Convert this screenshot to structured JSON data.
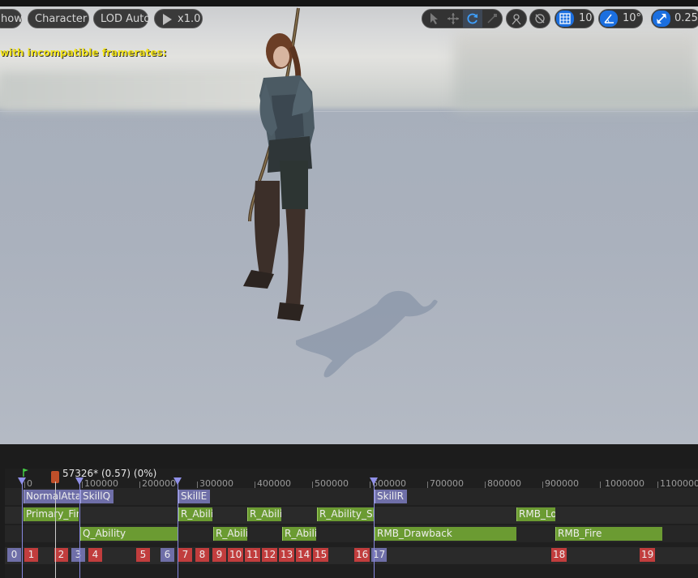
{
  "toolbar": {
    "show_label": "how",
    "character_label": "Character",
    "lod_label": "LOD Auto",
    "speed_label": "x1.0",
    "grid_value": "10",
    "angle_value": "10°",
    "scale_value": "0.25"
  },
  "viewport": {
    "warning": "with incompatible framerates:"
  },
  "timeline": {
    "scrub_label": "57326* (0.57) (0%)",
    "ruler": [
      "0",
      "100000",
      "200000",
      "300000",
      "400000",
      "500000",
      "600000",
      "700000",
      "800000",
      "900000",
      "1000000",
      "1100000"
    ],
    "row1": [
      "NormalAttack",
      "SkillQ",
      "SkillE",
      "SkillR"
    ],
    "row2": [
      "Primary_Fire",
      "R_Ability",
      "R_Ability",
      "R_Ability_Slot",
      "RMB_Loop"
    ],
    "row3": [
      "Q_Ability",
      "R_Ability",
      "R_Ability",
      "RMB_Drawback",
      "RMB_Fire"
    ],
    "markers": [
      "0",
      "1",
      "2",
      "3",
      "4",
      "5",
      "6",
      "7",
      "8",
      "9",
      "10",
      "11",
      "12",
      "13",
      "14",
      "15",
      "16",
      "17",
      "18",
      "19"
    ]
  },
  "colors": {
    "accent_blue": "#1b6fe0",
    "warning_yellow": "#f1e21a",
    "notify_purple": "#6f6fa8",
    "notify_green": "#6b9b32",
    "marker_red": "#c13d3d"
  },
  "icons": [
    "play-icon",
    "select-icon",
    "move-icon",
    "rotate-icon",
    "scale-icon",
    "coordinate-icon",
    "surface-snap-icon",
    "grid-snap-icon",
    "angle-snap-icon",
    "scale-snap-icon"
  ]
}
